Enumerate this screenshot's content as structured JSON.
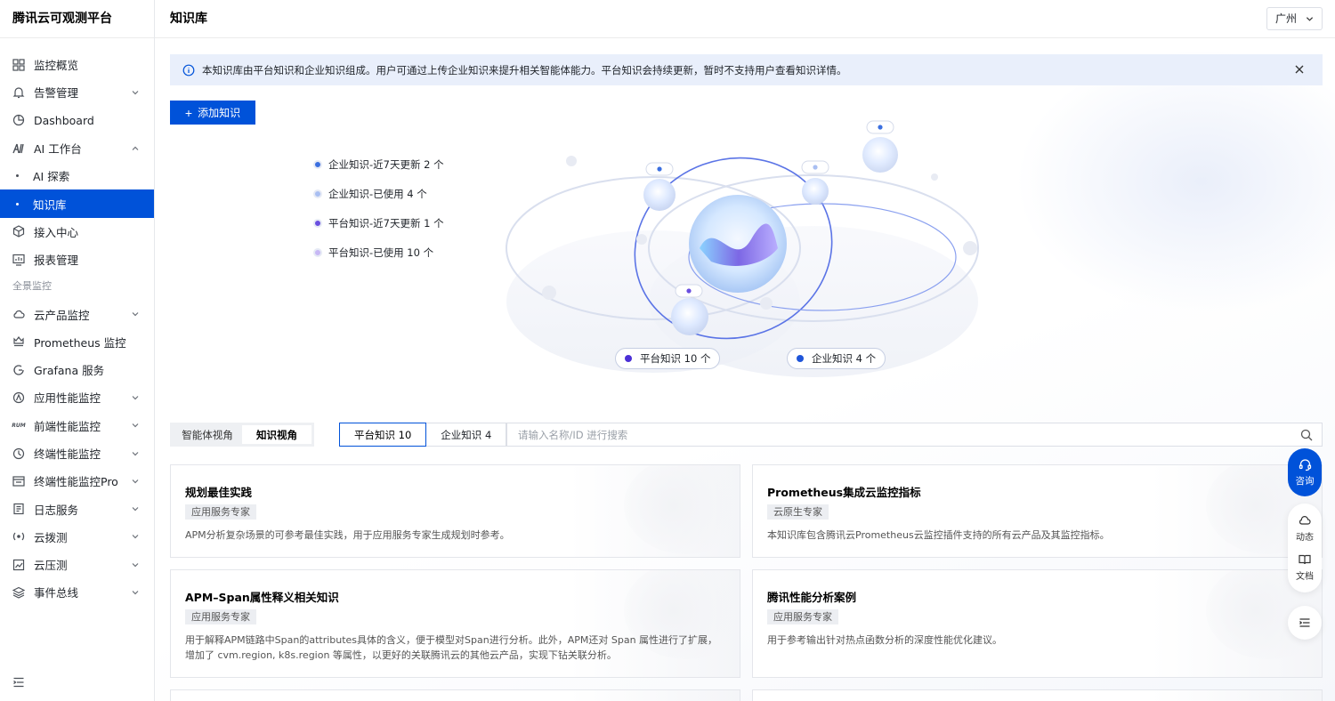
{
  "brand": "腾讯云可观测平台",
  "header": {
    "title": "知识库",
    "region": "广州"
  },
  "sidebar": {
    "items": [
      {
        "label": "监控概览",
        "icon": "grid-icon",
        "chevron": false,
        "active": false,
        "sub": false
      },
      {
        "label": "告警管理",
        "icon": "bell-icon",
        "chevron": "down",
        "active": false,
        "sub": false
      },
      {
        "label": "Dashboard",
        "icon": "dashboard-icon",
        "chevron": false,
        "active": false,
        "sub": false
      },
      {
        "label": "AI 工作台",
        "icon": "ai-icon",
        "chevron": "up",
        "active": false,
        "sub": false
      },
      {
        "label": "AI 探索",
        "icon": "",
        "chevron": false,
        "active": false,
        "sub": true
      },
      {
        "label": "知识库",
        "icon": "",
        "chevron": false,
        "active": true,
        "sub": true
      },
      {
        "label": "接入中心",
        "icon": "cube-icon",
        "chevron": false,
        "active": false,
        "sub": false
      },
      {
        "label": "报表管理",
        "icon": "report-icon",
        "chevron": false,
        "active": false,
        "sub": false
      }
    ],
    "section_label": "全景监控",
    "section_items": [
      {
        "label": "云产品监控",
        "icon": "cloud-icon",
        "chevron": "down"
      },
      {
        "label": "Prometheus 监控",
        "icon": "prometheus-icon",
        "chevron": false
      },
      {
        "label": "Grafana 服务",
        "icon": "grafana-icon",
        "chevron": false
      },
      {
        "label": "应用性能监控",
        "icon": "apm-icon",
        "chevron": "down"
      },
      {
        "label": "前端性能监控",
        "icon": "rum-icon",
        "chevron": "down"
      },
      {
        "label": "终端性能监控",
        "icon": "terminal-perf-icon",
        "chevron": "down"
      },
      {
        "label": "终端性能监控Pro",
        "icon": "terminal-pro-icon",
        "chevron": "down"
      },
      {
        "label": "日志服务",
        "icon": "log-icon",
        "chevron": "down"
      },
      {
        "label": "云拨测",
        "icon": "probe-icon",
        "chevron": "down"
      },
      {
        "label": "云压测",
        "icon": "pressure-icon",
        "chevron": "down"
      },
      {
        "label": "事件总线",
        "icon": "layers-icon",
        "chevron": "down"
      }
    ],
    "rum_glyph": "RUM"
  },
  "notice": {
    "text": "本知识库由平台知识和企业知识组成。用户可通过上传企业知识来提升相关智能体能力。平台知识会持续更新，暂时不支持用户查看知识详情。"
  },
  "add_button": {
    "plus": "+",
    "label": "添加知识"
  },
  "legend": [
    {
      "label": "企业知识-近7天更新 2 个",
      "color": "#3b6fe0"
    },
    {
      "label": "企业知识-已使用 4 个",
      "color": "#a9bff2"
    },
    {
      "label": "平台知识-近7天更新 1 个",
      "color": "#6a4fe0"
    },
    {
      "label": "平台知识-已使用 10 个",
      "color": "#c7b8f5"
    }
  ],
  "pills": [
    {
      "label": "平台知识 10 个",
      "color": "#4b2fd6"
    },
    {
      "label": "企业知识 4 个",
      "color": "#1f55d9"
    }
  ],
  "view_toggle": {
    "options": [
      "智能体视角",
      "知识视角"
    ],
    "selected": 1
  },
  "tabs": [
    {
      "label": "平台知识 10",
      "active": true
    },
    {
      "label": "企业知识 4",
      "active": false
    }
  ],
  "search": {
    "placeholder": "请输入名称/ID 进行搜索",
    "value": ""
  },
  "cards": [
    {
      "title": "规划最佳实践",
      "tag": "应用服务专家",
      "desc": "APM分析复杂场景的可参考最佳实践，用于应用服务专家生成规划时参考。"
    },
    {
      "title": "Prometheus集成云监控指标",
      "tag": "云原生专家",
      "desc": "本知识库包含腾讯云Prometheus云监控插件支持的所有云产品及其监控指标。"
    },
    {
      "title": "APM–Span属性释义相关知识",
      "tag": "应用服务专家",
      "desc": "用于解释APM链路中Span的attributes具体的含义，便于模型对Span进行分析。此外，APM还对 Span 属性进行了扩展，增加了 cvm.region, k8s.region 等属性，以更好的关联腾讯云的其他云产品，实现下钻关联分析。"
    },
    {
      "title": "腾讯性能分析案例",
      "tag": "应用服务专家",
      "desc": "用于参考输出针对热点函数分析的深度性能优化建议。"
    }
  ],
  "float": {
    "consult": "咨询",
    "news": "动态",
    "docs": "文档"
  },
  "colors": {
    "accent": "#0052d9",
    "notice_bg": "#e9effb"
  }
}
